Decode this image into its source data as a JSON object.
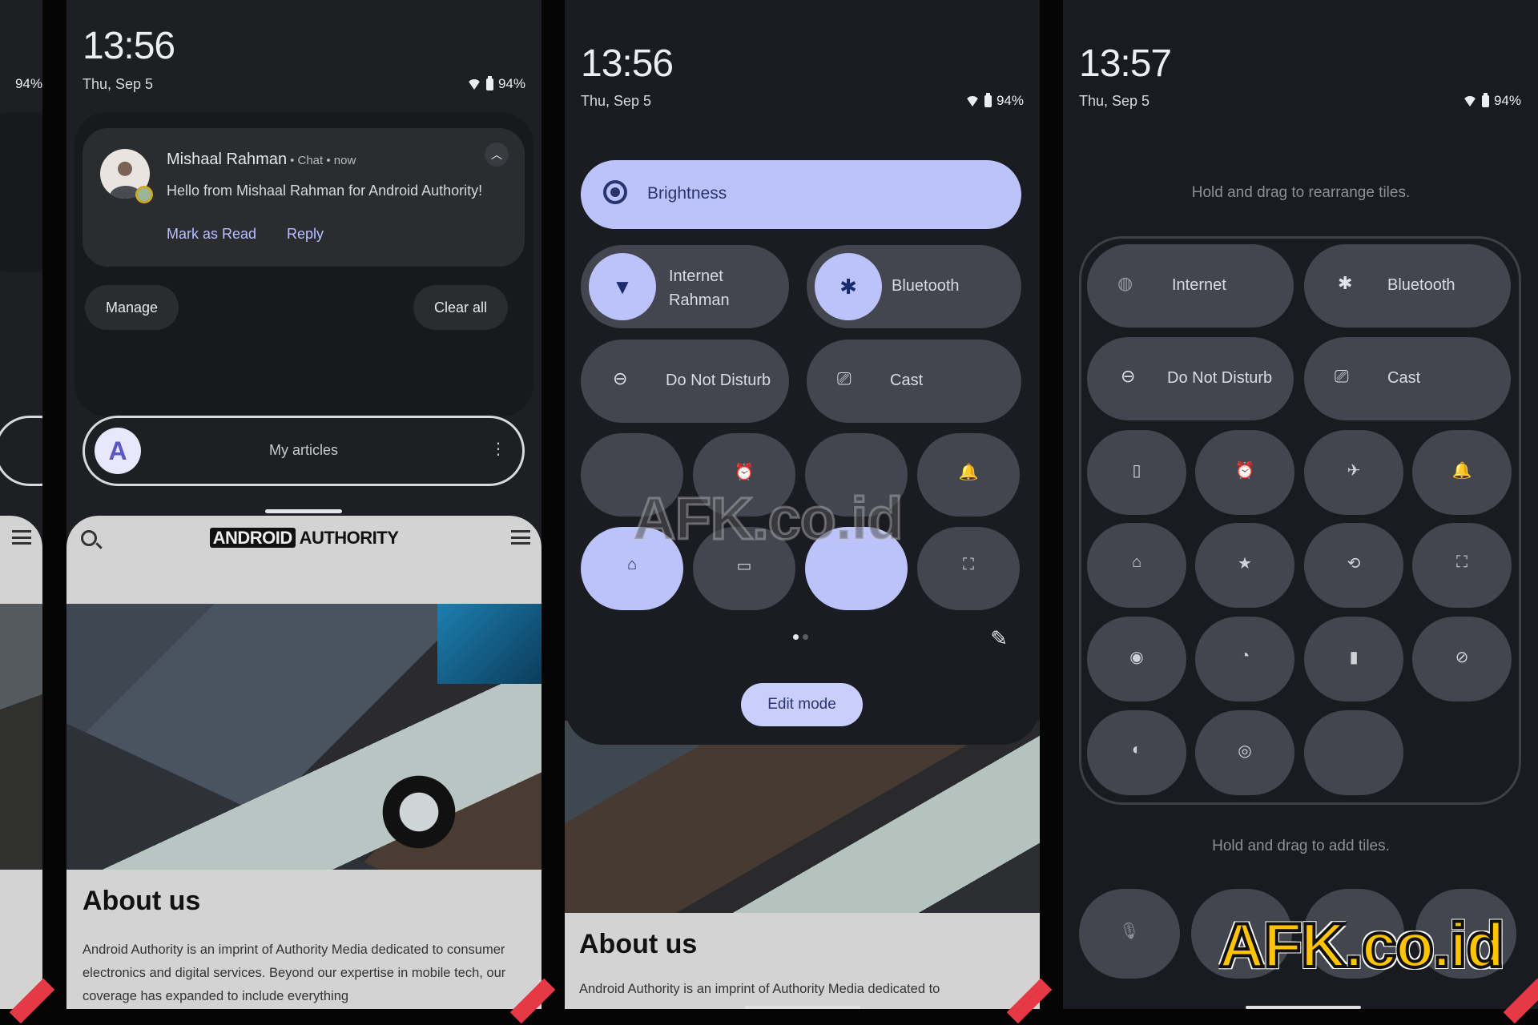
{
  "status_bar": {
    "battery": "94%",
    "wifi_icon": "wifi-icon",
    "battery_icon": "battery-icon"
  },
  "panel_left_partial": {
    "battery": "94%"
  },
  "panel_notifications": {
    "clock": "13:56",
    "date": "Thu, Sep 5",
    "battery": "94%",
    "notification": {
      "sender": "Mishaal Rahman",
      "meta": "• Chat • now",
      "body": "Hello from Mishaal Rahman for Android Authority!",
      "actions": [
        "Mark as Read",
        "Reply"
      ],
      "collapse_icon": "chevron-up-icon"
    },
    "buttons": {
      "manage": "Manage",
      "clear_all": "Clear all"
    },
    "widget": {
      "icon_letter": "A",
      "label": "My articles",
      "more_icon": "⋮"
    },
    "browser": {
      "logo_boxed": "ANDROID",
      "logo_text": "AUTHORITY",
      "heading": "About us",
      "body": "Android Authority is an imprint of Authority Media dedicated to consumer electronics and digital services. Beyond our expertise in mobile tech, our coverage has expanded to include everything"
    }
  },
  "panel_quick_settings": {
    "clock": "13:56",
    "date": "Thu, Sep 5",
    "battery": "94%",
    "brightness": {
      "label": "Brightness"
    },
    "large_tiles": [
      {
        "label": "Internet",
        "sublabel": "Rahman",
        "icon": "wifi-icon",
        "active": true
      },
      {
        "label": "Bluetooth",
        "sublabel": "",
        "icon": "bluetooth-icon",
        "active": true
      },
      {
        "label": "Do Not Disturb",
        "icon": "do-not-disturb-icon",
        "active": false
      },
      {
        "label": "Cast",
        "icon": "cast-icon",
        "active": false
      }
    ],
    "small_tiles": [
      {
        "icon": "",
        "active": false
      },
      {
        "icon": "alarm-icon",
        "glyph": "⏰",
        "active": false
      },
      {
        "icon": "",
        "active": false
      },
      {
        "icon": "bell-ring-icon",
        "glyph": "🔔",
        "active": false
      },
      {
        "icon": "home-icon",
        "glyph": "⌂",
        "active": true
      },
      {
        "icon": "wallet-icon",
        "glyph": "▭",
        "active": false
      },
      {
        "icon": "",
        "active": true
      },
      {
        "icon": "qr-scan-icon",
        "glyph": "⛶",
        "active": false
      }
    ],
    "pager": {
      "pages": 2,
      "current": 1
    },
    "edit_mode_button": "Edit mode",
    "edit_icon": "pencil-icon",
    "browser_heading": "About us",
    "browser_body": "Android Authority is an imprint of Authority Media dedicated to",
    "watermark": "AFK.co.id"
  },
  "panel_edit_mode": {
    "clock": "13:57",
    "date": "Thu, Sep 5",
    "battery": "94%",
    "rearrange_hint": "Hold and drag to rearrange tiles.",
    "large_tiles": [
      {
        "label": "Internet",
        "icon": "internet-unknown-icon",
        "glyph": "🌐"
      },
      {
        "label": "Bluetooth",
        "icon": "bluetooth-icon",
        "glyph": "✱"
      },
      {
        "label": "Do Not Disturb",
        "icon": "do-not-disturb-icon",
        "glyph": "⊖"
      },
      {
        "label": "Cast",
        "icon": "cast-icon",
        "glyph": "⎚"
      }
    ],
    "small_tiles": [
      {
        "icon": "flashlight-icon",
        "glyph": "▯"
      },
      {
        "icon": "alarm-icon",
        "glyph": "⏰"
      },
      {
        "icon": "airplane-icon",
        "glyph": "✈"
      },
      {
        "icon": "bell-ring-icon",
        "glyph": "🔔"
      },
      {
        "icon": "home-icon",
        "glyph": "⌂"
      },
      {
        "icon": "star-icon",
        "glyph": "★"
      },
      {
        "icon": "rotate-icon",
        "glyph": "⟲"
      },
      {
        "icon": "qr-scan-icon",
        "glyph": "⛶"
      },
      {
        "icon": "screen-record-icon",
        "glyph": "◉"
      },
      {
        "icon": "data-saver-icon",
        "glyph": "◔"
      },
      {
        "icon": "battery-saver-icon",
        "glyph": "▮"
      },
      {
        "icon": "camera-off-icon",
        "glyph": "⊘"
      },
      {
        "icon": "color-inversion-icon",
        "glyph": "◐"
      },
      {
        "icon": "hotspot-icon",
        "glyph": "◎"
      },
      {
        "icon": "",
        "glyph": ""
      }
    ],
    "add_hint": "Hold and drag to add tiles.",
    "available_tiles": [
      {
        "icon": "mic-off-icon",
        "glyph": "🎙"
      },
      {
        "icon": "",
        "glyph": ""
      },
      {
        "icon": "",
        "glyph": ""
      },
      {
        "icon": "",
        "glyph": ""
      }
    ],
    "watermark": "AFK.co.id"
  }
}
